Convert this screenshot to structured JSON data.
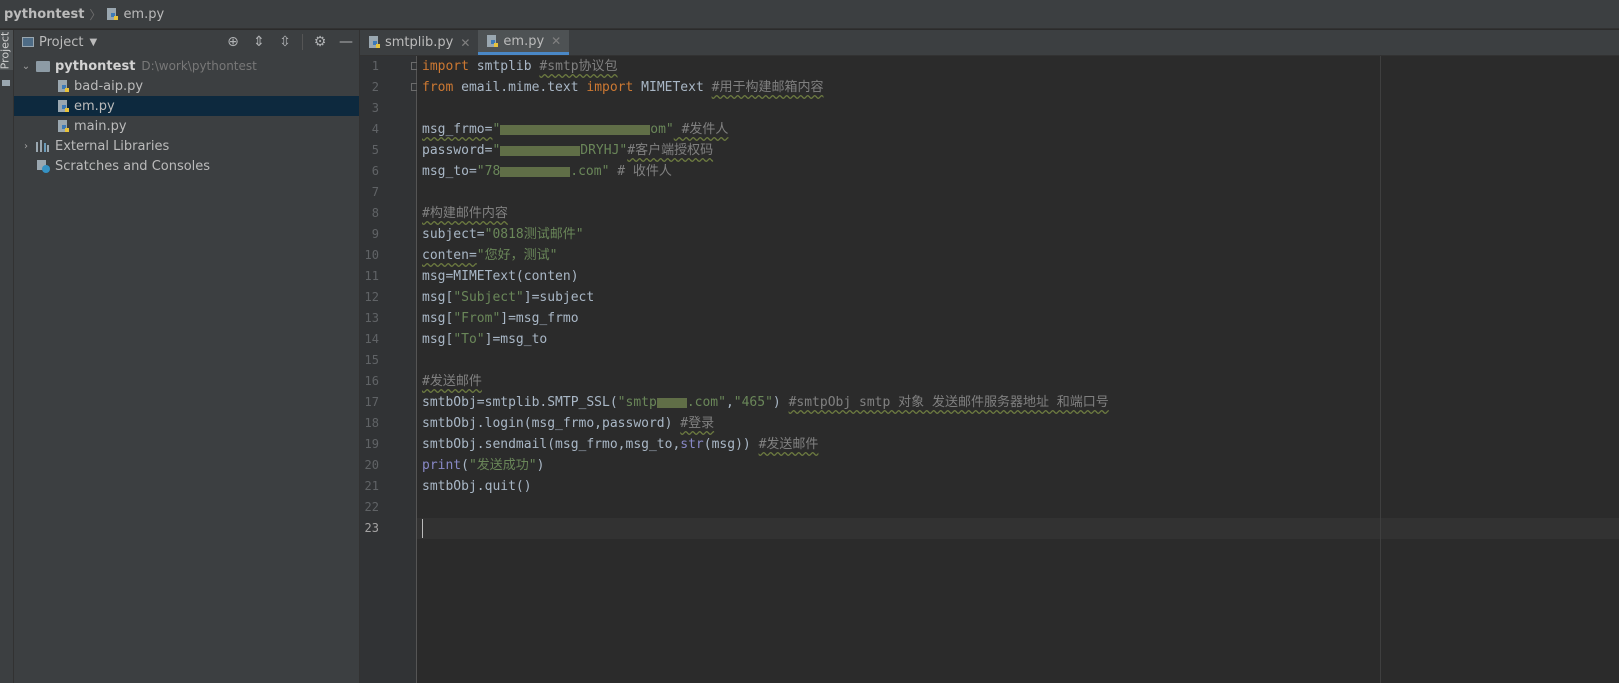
{
  "breadcrumb": {
    "project": "pythontest",
    "file": "em.py"
  },
  "toolstrip": {
    "project_tab_label": "Project"
  },
  "project_panel": {
    "title": "Project",
    "tree": {
      "root_name": "pythontest",
      "root_path": "D:\\work\\pythontest",
      "files": [
        "bad-aip.py",
        "em.py",
        "main.py"
      ],
      "selected_file": "em.py",
      "external_libraries": "External Libraries",
      "scratches": "Scratches and Consoles"
    }
  },
  "tabs": [
    {
      "label": "smtplib.py",
      "active": false
    },
    {
      "label": "em.py",
      "active": true
    }
  ],
  "editor": {
    "current_line": 23,
    "line_numbers": [
      "1",
      "2",
      "3",
      "4",
      "5",
      "6",
      "7",
      "8",
      "9",
      "10",
      "11",
      "12",
      "13",
      "14",
      "15",
      "16",
      "17",
      "18",
      "19",
      "20",
      "21",
      "22",
      "23"
    ],
    "code": {
      "l1_import": "import",
      "l1_mod": " smtplib ",
      "l1_comment": "#smtp协议包",
      "l2_from": "from",
      "l2_mod": " email.mime.text ",
      "l2_import": "import",
      "l2_name": " MIMEText ",
      "l2_comment": "#用于构建邮箱内容",
      "l4_var": "msg_frmo=",
      "l4_str_end": "om\"",
      "l4_comment": " #发件人",
      "l5_var": "password=",
      "l5_str_end": "DRYHJ\"",
      "l5_comment": "#客户端授权码",
      "l6_var": "msg_to=",
      "l6_str_start": "\"78",
      "l6_str_end": ".com\"",
      "l6_comment": " # 收件人",
      "l8_comment": "#构建邮件内容",
      "l9_var": "subject=",
      "l9_str": "\"0818测试邮件\"",
      "l10_var": "conten=",
      "l10_str": "\"您好，测试\"",
      "l11": "msg=MIMEText(conten)",
      "l12_a": "msg[",
      "l12_str": "\"Subject\"",
      "l12_b": "]=subject",
      "l13_a": "msg[",
      "l13_str": "\"From\"",
      "l13_b": "]=msg_frmo",
      "l14_a": "msg[",
      "l14_str": "\"To\"",
      "l14_b": "]=msg_to",
      "l16_comment": "#发送邮件",
      "l17_a": "smtbObj=smtplib.SMTP_SSL(",
      "l17_str1_start": "\"smtp",
      "l17_str1_end": ".com\"",
      "l17_comma": ",",
      "l17_str2": "\"465\"",
      "l17_b": ") ",
      "l17_comment": "#smtpObj smtp 对象 发送邮件服务器地址 和端口号",
      "l18_a": "smtbObj.login(msg_frmo,password) ",
      "l18_comment": "#登录",
      "l19_a": "smtbObj.sendmail(msg_frmo,msg_to,",
      "l19_bi": "str",
      "l19_b": "(msg)) ",
      "l19_comment": "#发送邮件",
      "l20_bi": "print",
      "l20_a": "(",
      "l20_str": "\"发送成功\"",
      "l20_b": ")",
      "l21": "smtbObj.quit()"
    }
  },
  "colors": {
    "background": "#2b2b2b",
    "keyword": "#cc7832",
    "string": "#6a8759",
    "comment": "#808080",
    "builtin": "#8888c6",
    "selection": "#0d293e",
    "active_tab_underline": "#4a88c7"
  }
}
